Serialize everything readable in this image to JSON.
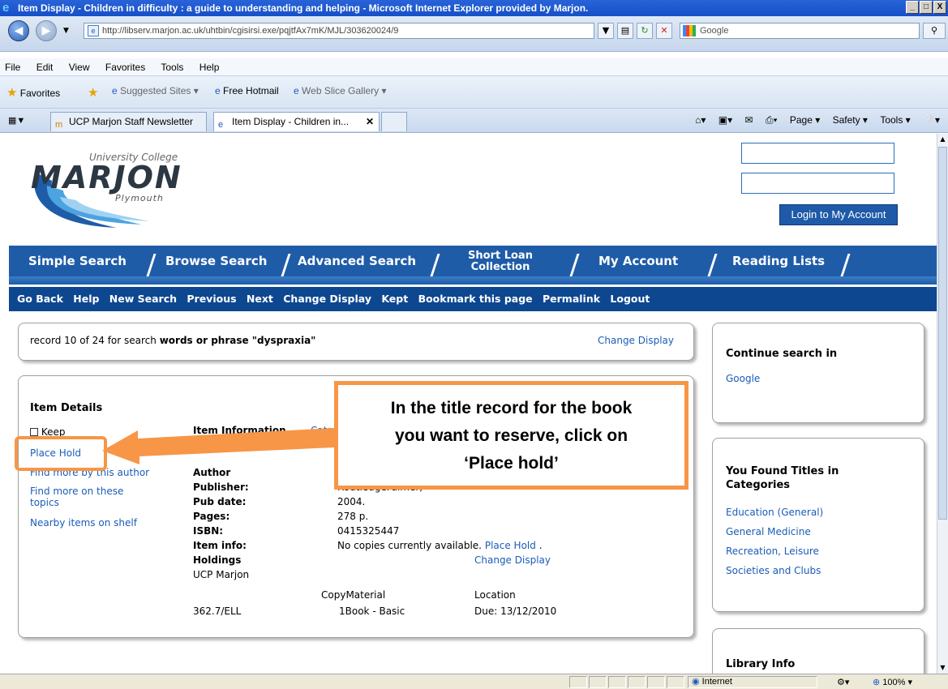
{
  "window": {
    "title": "Item Display - Children in difficulty : a guide to understanding and helping - Microsoft Internet Explorer provided by Marjon.",
    "controls": [
      "_",
      "□",
      "X"
    ]
  },
  "address": {
    "url": "http://libserv.marjon.ac.uk/uhtbin/cgisirsi.exe/pqjtfAx7mK/MJL/303620024/9",
    "search_provider": "Google"
  },
  "menu": [
    "File",
    "Edit",
    "View",
    "Favorites",
    "Tools",
    "Help"
  ],
  "favorites_bar": {
    "favorites_label": "Favorites",
    "suggested": "Suggested Sites ▾",
    "hotmail": "Free Hotmail",
    "webslice": "Web Slice Gallery ▾"
  },
  "tabs": [
    {
      "label": "UCP Marjon Staff Newsletter",
      "active": false
    },
    {
      "label": "Item Display - Children in...",
      "active": true
    }
  ],
  "command_bar": {
    "page": "Page ▾",
    "safety": "Safety ▾",
    "tools": "Tools ▾"
  },
  "logo": {
    "top": "University College",
    "name": "MARJON",
    "place": "Plymouth"
  },
  "login": {
    "button": "Login to My Account"
  },
  "main_nav": [
    "Simple Search",
    "Browse Search",
    "Advanced Search",
    "Short Loan",
    "Collection",
    "My Account",
    "Reading Lists"
  ],
  "sub_nav": [
    "Go Back",
    "Help",
    "New Search",
    "Previous",
    "Next",
    "Change Display",
    "Kept",
    "Bookmark this page",
    "Permalink",
    "Logout"
  ],
  "record": {
    "prefix": "record 10 of 24 for search",
    "query": "words or phrase \"dyspraxia\"",
    "change_display": "Change Display"
  },
  "item_details": {
    "heading": "Item Details",
    "keep": "Keep",
    "place_hold": "Place Hold",
    "find_author": "Find more by this author",
    "find_topics_1": "Find more on these",
    "find_topics_2": "topics",
    "nearby": "Nearby items on shelf",
    "info_heading": "Item Information",
    "info_link": "Cata",
    "fields": [
      {
        "label": "Author",
        "value": ""
      },
      {
        "label": "Publisher:",
        "value": "RoutledgeFalmer,"
      },
      {
        "label": "Pub date:",
        "value": "2004."
      },
      {
        "label": "Pages:",
        "value": "278 p."
      },
      {
        "label": "ISBN:",
        "value": "0415325447"
      },
      {
        "label": "Item info:",
        "value": "No copies currently available."
      }
    ],
    "item_info_link": "Place Hold",
    "holdings": "Holdings",
    "holdings_change": "Change Display",
    "library": "UCP Marjon",
    "copy_col": "CopyMaterial",
    "location_col": "Location",
    "call_number": "362.7/ELL",
    "copy": "1Book - Basic",
    "due": "Due: 13/12/2010"
  },
  "callout": {
    "line1": "In the title record for the book",
    "line2": "you want to reserve, click on",
    "line3": "‘Place hold’"
  },
  "sidebar": {
    "continue_heading": "Continue search in",
    "continue_link": "Google",
    "found_heading_1": "You Found Titles in",
    "found_heading_2": "Categories",
    "categories": [
      "Education (General)",
      "General Medicine",
      "Recreation, Leisure",
      "Societies and Clubs"
    ],
    "library_info": "Library Info"
  },
  "status": {
    "zone": "Internet",
    "zoom": "100%"
  },
  "colors": {
    "accent_orange": "#f79646",
    "nav_blue": "#1f5ca8",
    "link": "#1a5cb8"
  }
}
